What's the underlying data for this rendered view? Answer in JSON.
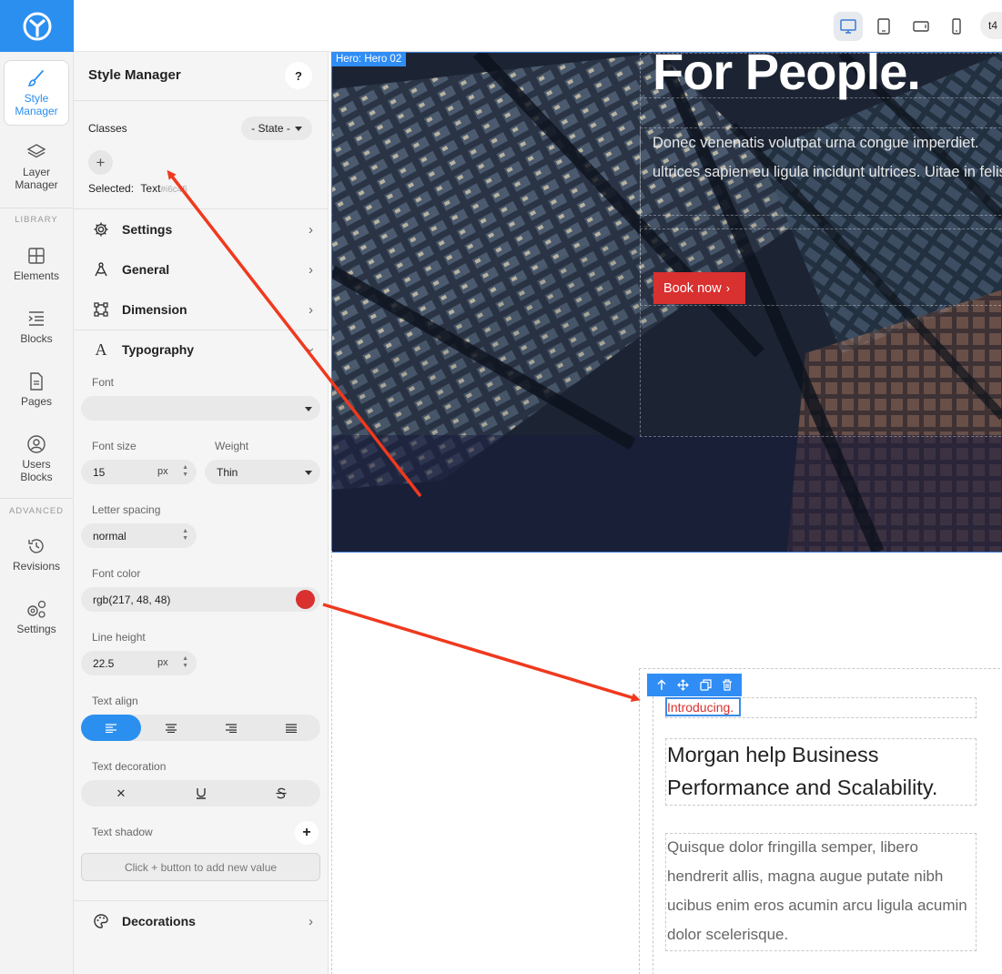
{
  "rail": {
    "style_manager": "Style\nManager",
    "layer_manager": "Layer\nManager",
    "library_heading": "LIBRARY",
    "elements": "Elements",
    "blocks": "Blocks",
    "pages": "Pages",
    "users_blocks": "Users\nBlocks",
    "advanced_heading": "ADVANCED",
    "revisions": "Revisions",
    "settings": "Settings"
  },
  "panel": {
    "title": "Style Manager",
    "help": "?",
    "classes_label": "Classes",
    "state_label": "- State -",
    "selected_label": "Selected:",
    "selected_value": "Text",
    "selected_id": "#i6c45",
    "sections": {
      "settings": "Settings",
      "general": "General",
      "dimension": "Dimension",
      "typography": "Typography",
      "decorations": "Decorations"
    },
    "typography": {
      "font_label": "Font",
      "font_value": "",
      "font_size_label": "Font size",
      "font_size_value": "15",
      "font_size_unit": "px",
      "weight_label": "Weight",
      "weight_value": "Thin",
      "letter_spacing_label": "Letter spacing",
      "letter_spacing_value": "normal",
      "font_color_label": "Font color",
      "font_color_value": "rgb(217, 48, 48)",
      "font_color_swatch": "#d93030",
      "line_height_label": "Line height",
      "line_height_value": "22.5",
      "line_height_unit": "px",
      "text_align_label": "Text align",
      "text_decoration_label": "Text decoration",
      "text_shadow_label": "Text shadow",
      "add_value_hint": "Click + button to add new value"
    }
  },
  "topbar": {
    "user_initials": "t4"
  },
  "canvas": {
    "hero_badge": "Hero: Hero 02",
    "hero_title": "For People.",
    "hero_body": "Donec venenatis volutpat urna congue imperdiet. ultrices sapien eu ligula incidunt ultrices. Uitae in felis.",
    "book_button": "Book now",
    "intro": "Introducing.",
    "heading": "Morgan help Business Performance and Scalability.",
    "paragraph": "Quisque dolor fringilla semper, libero hendrerit allis, magna augue putate nibh ucibus enim eros acumin arcu ligula acumin dolor scelerisque."
  },
  "colors": {
    "accent": "#2b8ff0",
    "brand_red": "#d93030",
    "annotation_arrow": "#f0391e"
  }
}
